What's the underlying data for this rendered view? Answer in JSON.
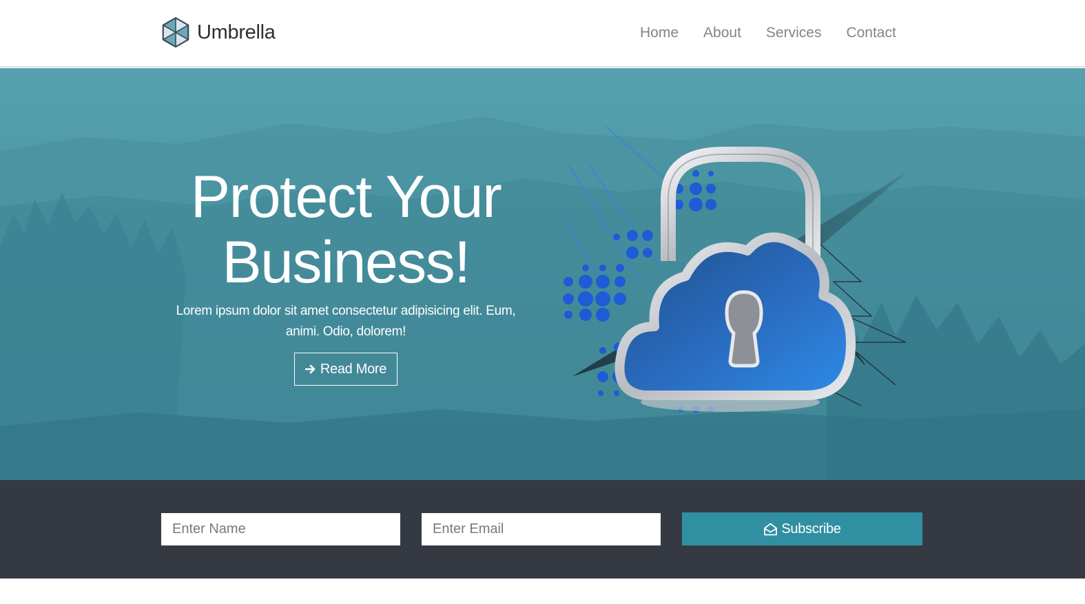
{
  "brand": {
    "name": "Umbrella",
    "logo_icon": "umbrella-logo-icon"
  },
  "nav": {
    "items": [
      {
        "label": "Home"
      },
      {
        "label": "About"
      },
      {
        "label": "Services"
      },
      {
        "label": "Contact"
      }
    ]
  },
  "hero": {
    "title": "Protect Your Business!",
    "text": "Lorem ipsum dolor sit amet consectetur adipisicing elit. Eum, animi. Odio, dolorem!",
    "button_label": "Read More",
    "button_icon": "arrow-right-icon",
    "image_icon": "cloud-padlock-illustration"
  },
  "subscribe": {
    "name_placeholder": "Enter Name",
    "email_placeholder": "Enter Email",
    "button_label": "Subscribe",
    "button_icon": "envelope-open-icon"
  },
  "colors": {
    "hero_teal": "#4b97a4",
    "subscribe_bar": "#353a42",
    "accent": "#318fa2",
    "nav_text": "#808589",
    "brand_text": "#2b2f33"
  }
}
